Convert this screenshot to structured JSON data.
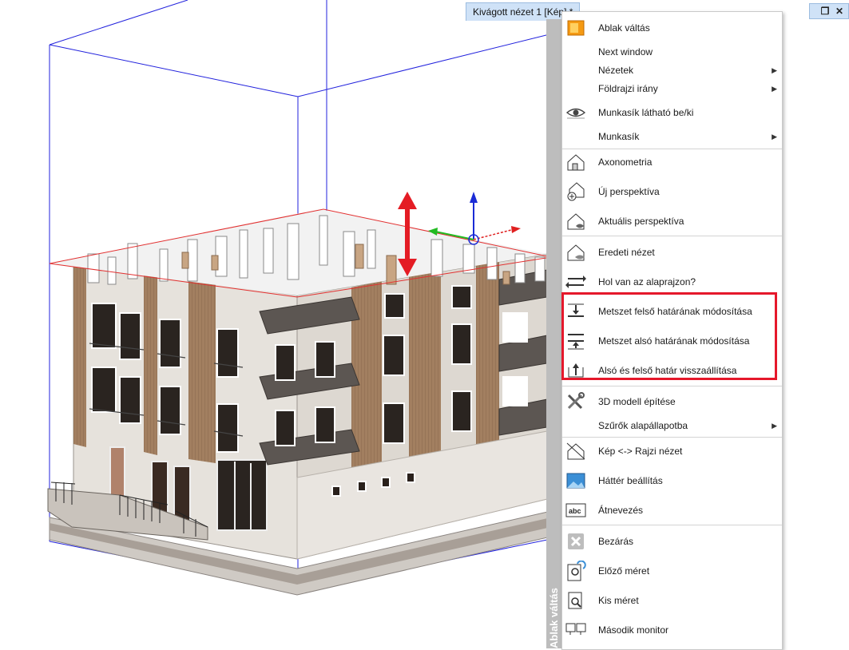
{
  "window": {
    "tab_title": "Kivágott nézet 1 [Kép] *",
    "sidebar_label": "Ablak váltás"
  },
  "context_menu": {
    "items": [
      {
        "label": "Ablak váltás",
        "icon": "window-switch-icon",
        "submenu": false
      },
      {
        "label": "Next window",
        "icon": "",
        "submenu": false
      },
      {
        "label": "Nézetek",
        "icon": "",
        "submenu": true
      },
      {
        "label": "Földrajzi irány",
        "icon": "",
        "submenu": true
      },
      {
        "label": "Munkasík látható be/ki",
        "icon": "eye-icon",
        "submenu": false
      },
      {
        "label": "Munkasík",
        "icon": "",
        "submenu": true
      },
      {
        "label": "Axonometria",
        "icon": "house-axonometry-icon",
        "submenu": false
      },
      {
        "label": "Új perspektíva",
        "icon": "house-new-perspective-icon",
        "submenu": false
      },
      {
        "label": "Aktuális perspektíva",
        "icon": "house-current-perspective-icon",
        "submenu": false
      },
      {
        "label": "Eredeti nézet",
        "icon": "house-original-view-icon",
        "submenu": false
      },
      {
        "label": "Hol van az alaprajzon?",
        "icon": "arrows-swap-icon",
        "submenu": false
      },
      {
        "label": "Metszet felső határának módosítása",
        "icon": "section-top-limit-icon",
        "submenu": false
      },
      {
        "label": "Metszet alsó határának módosítása",
        "icon": "section-bottom-limit-icon",
        "submenu": false
      },
      {
        "label": "Alsó és felső határ visszaállítása",
        "icon": "section-reset-limits-icon",
        "submenu": false
      },
      {
        "label": "3D modell építése",
        "icon": "tools-icon",
        "submenu": false
      },
      {
        "label": "Szűrők alapállapotba",
        "icon": "",
        "submenu": true
      },
      {
        "label": "Kép <-> Rajzi nézet",
        "icon": "house-image-drawing-icon",
        "submenu": false
      },
      {
        "label": "Háttér beállítás",
        "icon": "background-image-icon",
        "submenu": false
      },
      {
        "label": "Átnevezés",
        "icon": "rename-abc-icon",
        "submenu": false
      },
      {
        "label": "Bezárás",
        "icon": "close-icon",
        "submenu": false
      },
      {
        "label": "Előző méret",
        "icon": "previous-zoom-icon",
        "submenu": false
      },
      {
        "label": "Kis méret",
        "icon": "small-size-icon",
        "submenu": false
      },
      {
        "label": "Második monitor",
        "icon": "second-monitor-icon",
        "submenu": false
      }
    ]
  },
  "colors": {
    "highlight_box": "#e5182b",
    "bounding_box": "#2222dd",
    "section_plane": "#e23030",
    "gizmo_z": "#1a2bd6",
    "gizmo_x": "#e02020",
    "gizmo_y": "#22bb22",
    "facade_wood": "#9a7a5d",
    "facade_white": "#e8e4de",
    "balcony_dark": "#5a5450"
  }
}
